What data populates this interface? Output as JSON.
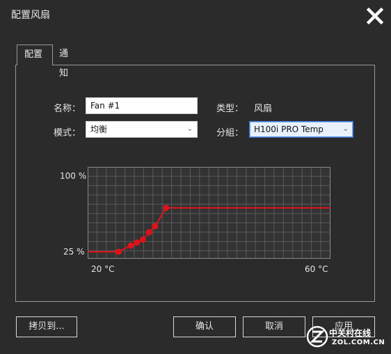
{
  "window": {
    "title": "配置风扇"
  },
  "tabs": [
    {
      "label": "配置"
    },
    {
      "label": "通知"
    }
  ],
  "form": {
    "name_label": "名称：",
    "name_value": "Fan #1",
    "type_label": "类型：",
    "type_value": "风扇",
    "mode_label": "模式：",
    "mode_value": "均衡",
    "group_label": "分組：",
    "group_value": "H100i PRO  Temp"
  },
  "chart_data": {
    "type": "line",
    "title": "",
    "xlabel": "",
    "ylabel": "",
    "y_tick_labels": [
      "100 %",
      "25 %"
    ],
    "x_tick_labels": [
      "20 °C",
      "60 °C"
    ],
    "xlim": [
      20,
      60
    ],
    "ylim": [
      25,
      100
    ],
    "grid": true,
    "series": [
      {
        "color": "#e0121a",
        "points": [
          {
            "x": 20,
            "y": 25
          },
          {
            "x": 25.1,
            "y": 25
          },
          {
            "x": 27.1,
            "y": 31
          },
          {
            "x": 28.1,
            "y": 34
          },
          {
            "x": 29.1,
            "y": 37
          },
          {
            "x": 30.1,
            "y": 44
          },
          {
            "x": 31.1,
            "y": 50
          },
          {
            "x": 32.9,
            "y": 68
          },
          {
            "x": 60,
            "y": 68
          }
        ],
        "markers": [
          {
            "x": 25.1,
            "y": 25
          },
          {
            "x": 27.1,
            "y": 31
          },
          {
            "x": 28.1,
            "y": 34
          },
          {
            "x": 29.1,
            "y": 37
          },
          {
            "x": 30.1,
            "y": 44
          },
          {
            "x": 31.1,
            "y": 50
          },
          {
            "x": 32.9,
            "y": 68
          }
        ]
      }
    ]
  },
  "buttons": {
    "copy": "拷贝到...",
    "ok": "确认",
    "cancel": "取消",
    "apply": "应用"
  },
  "watermark": {
    "cn": "中关村在线",
    "en": "ZOL.COM.CN"
  },
  "colors": {
    "background": "#2b2b2b",
    "accent": "#e0121a",
    "focus": "#3a78d6"
  }
}
